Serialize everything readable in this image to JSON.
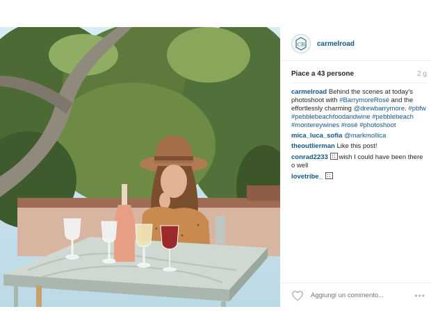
{
  "post": {
    "username": "carmelroad",
    "avatar_letters": "CR",
    "likes": "Piace a 43 persone",
    "time": "2 g",
    "caption": {
      "user": "carmelroad",
      "t1": " Behind the scenes at today's photoshoot with ",
      "tag1": "#BarrymoreRosé",
      "t2": " and the effortlessly charming ",
      "tag2": "@drewbarrymore",
      "t3": ".",
      "tags": "#pbfw #pebblebeachfoodandwine #pebblebeach #montereywines #rosé #photoshoot"
    },
    "comments": [
      {
        "user": "mica_luca_sofia",
        "mention": "@markmollica"
      },
      {
        "user": "theoutlierman",
        "text": " Like this post!"
      },
      {
        "user": "conrad2233",
        "text": "wish I could have been there o well"
      },
      {
        "user": "lovetribe_"
      }
    ],
    "add_comment_placeholder": "Aggiungi un commento...",
    "more_label": "•••",
    "icons": {
      "like": "heart-icon",
      "more": "more-options-icon"
    },
    "colors": {
      "link": "#125688",
      "text": "#262626",
      "muted": "#a5a7aa"
    }
  }
}
